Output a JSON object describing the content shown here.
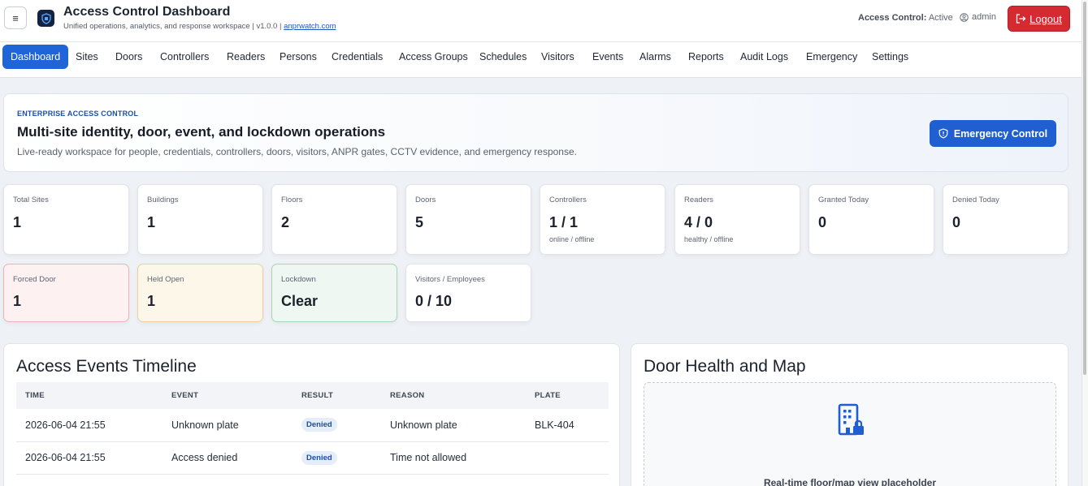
{
  "header": {
    "menu_glyph": "≡",
    "title": "Access Control Dashboard",
    "subtitle": "Unified operations, analytics, and response workspace | v1.0.0 | ",
    "subtitle_link": "anprwatch.com",
    "status_label": "Access Control:",
    "status_value": "Active",
    "user": "admin",
    "logout": "Logout"
  },
  "nav": {
    "items": [
      "Dashboard",
      "Sites",
      "Doors",
      "Controllers",
      "Readers",
      "Persons",
      "Credentials",
      "Access Groups",
      "Schedules",
      "Visitors",
      "Events",
      "Alarms",
      "Reports",
      "Audit Logs",
      "Emergency",
      "Settings"
    ],
    "active": "Dashboard"
  },
  "hero": {
    "eyebrow": "ENTERPRISE ACCESS CONTROL",
    "title": "Multi-site identity, door, event, and lockdown operations",
    "description": "Live-ready workspace for people, credentials, controllers, doors, visitors, ANPR gates, CCTV evidence, and emergency response.",
    "button": "Emergency Control"
  },
  "stats": [
    {
      "label": "Total Sites",
      "value": "1",
      "sub": ""
    },
    {
      "label": "Buildings",
      "value": "1",
      "sub": ""
    },
    {
      "label": "Floors",
      "value": "2",
      "sub": ""
    },
    {
      "label": "Doors",
      "value": "5",
      "sub": ""
    },
    {
      "label": "Controllers",
      "value": "1 / 1",
      "sub": "online / offline"
    },
    {
      "label": "Readers",
      "value": "4 / 0",
      "sub": "healthy / offline"
    },
    {
      "label": "Granted Today",
      "value": "0",
      "sub": ""
    },
    {
      "label": "Denied Today",
      "value": "0",
      "sub": ""
    },
    {
      "label": "Forced Door",
      "value": "1",
      "sub": ""
    },
    {
      "label": "Held Open",
      "value": "1",
      "sub": ""
    },
    {
      "label": "Lockdown",
      "value": "Clear",
      "sub": ""
    },
    {
      "label": "Visitors / Employees",
      "value": "0 / 10",
      "sub": ""
    }
  ],
  "timeline": {
    "title": "Access Events Timeline",
    "columns": [
      "TIME",
      "EVENT",
      "RESULT",
      "REASON",
      "PLATE"
    ],
    "rows": [
      {
        "time": "2026-06-04 21:55",
        "event": "Unknown plate",
        "result": "Denied",
        "reason": "Unknown plate",
        "plate": "BLK-404"
      },
      {
        "time": "2026-06-04 21:55",
        "event": "Access denied",
        "result": "Denied",
        "reason": "Time not allowed",
        "plate": ""
      }
    ]
  },
  "door_health": {
    "title": "Door Health and Map",
    "placeholder": "Real-time floor/map view placeholder"
  },
  "colors": {
    "primary": "#1f65d8",
    "danger": "#d42b32"
  }
}
